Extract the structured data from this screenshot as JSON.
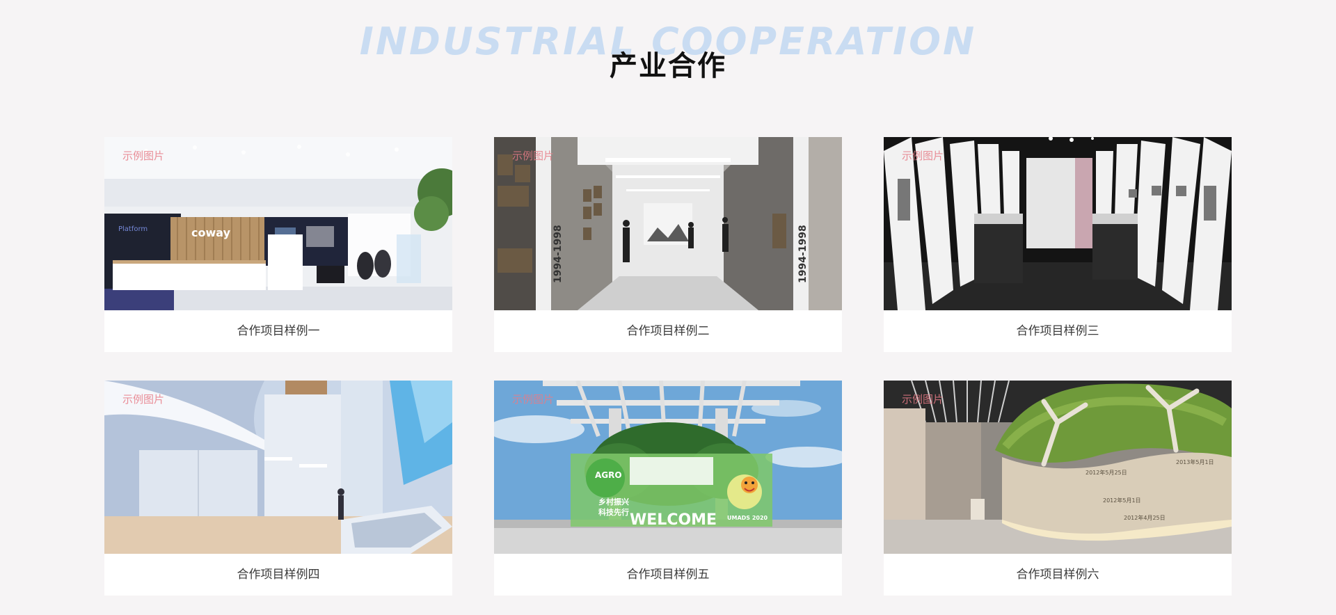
{
  "heading": {
    "en_title": "INDUSTRIAL COOPERATION",
    "cn_title": "产业合作"
  },
  "watermark_label": "示例图片",
  "cards": [
    {
      "caption": "合作项目样例一",
      "img_sign": "coway",
      "img_sign2": "Platform"
    },
    {
      "caption": "合作项目样例二",
      "img_sign": "1994-1998",
      "img_sign2": "1994-1998"
    },
    {
      "caption": "合作项目样例三"
    },
    {
      "caption": "合作项目样例四"
    },
    {
      "caption": "合作项目样例五",
      "img_sign": "WELCOME",
      "img_sign2": "AGRO",
      "img_sign3": "乡村振兴",
      "img_sign4": "科技先行",
      "img_sign5": "UMADS 2020"
    },
    {
      "caption": "合作项目样例六",
      "img_sign": "2012年5月25日",
      "img_sign2": "2013年5月1日",
      "img_sign3": "2012年5月1日",
      "img_sign4": "2012年4月25日"
    }
  ],
  "colors": {
    "background": "#f6f4f5",
    "en_title": "#c9dcf2",
    "watermark": "#e77b86",
    "caption": "#3a3a3a"
  }
}
